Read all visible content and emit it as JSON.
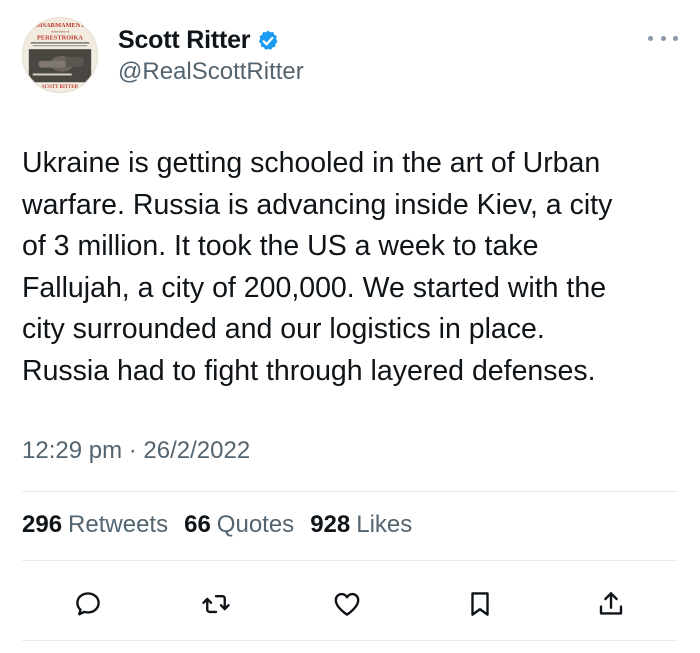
{
  "author": {
    "display_name": "Scott Ritter",
    "handle": "@RealScottRitter",
    "verified": true,
    "avatar_text": [
      "DISARMAMENT",
      "in the time of",
      "PERESTROIKA",
      "SCOTT RITTER"
    ]
  },
  "tweet": {
    "text": "Ukraine is getting schooled in the art of Urban\nwarfare. Russia is advancing inside Kiev, a city\nof 3 million. It took the US a week to take\nFallujah, a city of 200,000. We started with the\ncity surrounded and our logistics in place.\nRussia had to fight through layered defenses.",
    "timestamp": "12:29 pm · 26/2/2022"
  },
  "stats": {
    "retweets_count": "296",
    "retweets_label": "Retweets",
    "quotes_count": "66",
    "quotes_label": "Quotes",
    "likes_count": "928",
    "likes_label": "Likes"
  },
  "actions": [
    "reply-icon",
    "retweet-icon",
    "like-icon",
    "bookmark-icon",
    "share-icon"
  ],
  "colors": {
    "text": "#0f1419",
    "secondary": "#536471",
    "verified": "#1d9bf0",
    "divider": "#e7ecf0"
  }
}
